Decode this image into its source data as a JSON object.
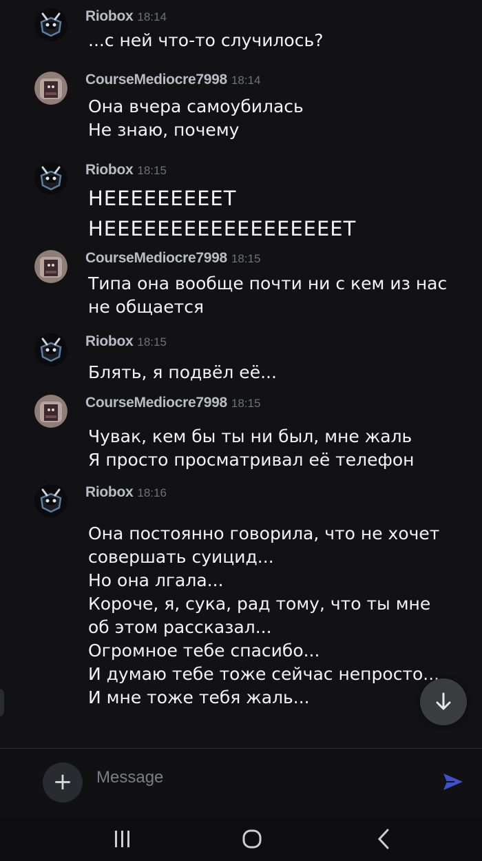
{
  "messages": [
    {
      "author": "Riobox",
      "time": "18:14",
      "avatar": "riobox",
      "lines": [
        "...с ней что-то случилось?"
      ]
    },
    {
      "author": "CourseMediocre7998",
      "time": "18:14",
      "avatar": "course",
      "lines": [
        "Она вчера самоубилась",
        "Не знаю, почему"
      ]
    },
    {
      "author": "Riobox",
      "time": "18:15",
      "avatar": "riobox",
      "big": true,
      "lines": [
        "НЕЕЕЕЕЕЕЕЕТ",
        "НЕЕЕЕЕЕЕЕЕЕЕЕЕЕЕЕЕЕТ"
      ]
    },
    {
      "author": "CourseMediocre7998",
      "time": "18:15",
      "avatar": "course",
      "lines": [
        "Типа она вообще почти ни с кем из нас",
        "не общается"
      ]
    },
    {
      "author": "Riobox",
      "time": "18:15",
      "avatar": "riobox",
      "lines": [
        "Блять, я подвёл её..."
      ]
    },
    {
      "author": "CourseMediocre7998",
      "time": "18:15",
      "avatar": "course",
      "lines": [
        "Чувак, кем бы ты ни был, мне жаль",
        "Я просто просматривал её телефон"
      ]
    },
    {
      "author": "Riobox",
      "time": "18:16",
      "avatar": "riobox",
      "lines": [
        "Она постоянно говорила, что не хочет",
        "совершать суицид...",
        "Но она лгала...",
        "Короче, я, сука, рад тому, что ты мне",
        "об этом рассказал...",
        "Огромное тебе спасибо...",
        "И думаю тебе тоже сейчас непросто...",
        "И мне тоже тебя жаль..."
      ]
    }
  ],
  "composer": {
    "placeholder": "Message",
    "plus_icon": "plus-icon",
    "send_icon": "send-icon"
  },
  "navbar": {
    "recents_icon": "recents-icon",
    "home_icon": "home-icon",
    "back_icon": "back-icon"
  },
  "scroll_button_icon": "arrow-down-icon",
  "colors": {
    "background": "#121214",
    "text": "#f4f4f4",
    "author": "#b9bcc2",
    "time": "#6e7178",
    "accent": "#5865f2"
  }
}
